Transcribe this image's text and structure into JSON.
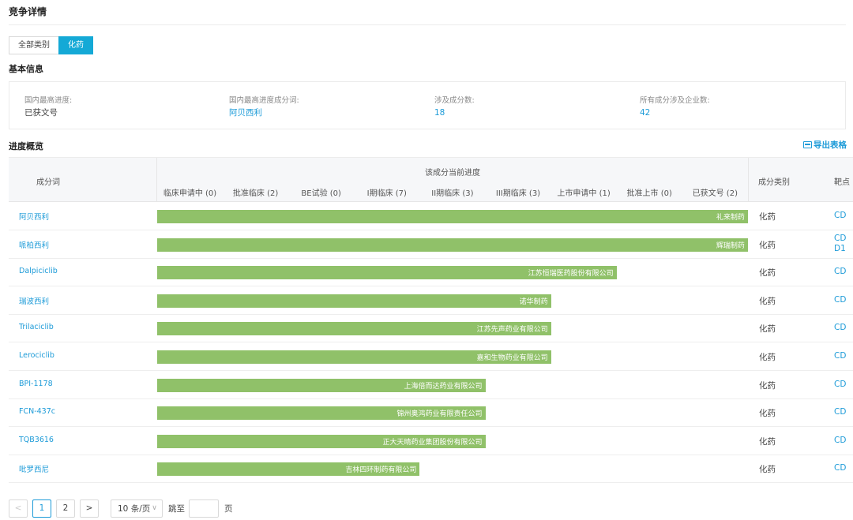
{
  "page": {
    "title": "竞争详情"
  },
  "category_tabs": [
    {
      "label": "全部类别",
      "active": false
    },
    {
      "label": "化药",
      "active": true
    }
  ],
  "basic_info": {
    "heading": "基本信息",
    "items": [
      {
        "label": "国内最高进度:",
        "value": "已获文号",
        "is_link": false
      },
      {
        "label": "国内最高进度成分词:",
        "value": "阿贝西利",
        "is_link": true
      },
      {
        "label": "涉及成分数:",
        "value": "18",
        "is_link": true
      },
      {
        "label": "所有成分涉及企业数:",
        "value": "42",
        "is_link": true
      }
    ]
  },
  "progress": {
    "heading": "进度概览",
    "export_label": "导出表格",
    "columns": {
      "name": "成分词",
      "progress_group": "该成分当前进度",
      "type": "成分类别",
      "target": "靶点"
    },
    "stages": [
      "临床申请中 (0)",
      "批准临床 (2)",
      "BE试验 (0)",
      "I期临床 (7)",
      "II期临床 (3)",
      "III期临床 (3)",
      "上市申请中 (1)",
      "批准上市 (0)",
      "已获文号 (2)"
    ],
    "bar_color": "#90c169",
    "rows": [
      {
        "name": "阿贝西利",
        "company": "礼来制药",
        "stage_reached": 9,
        "type": "化药",
        "target": [
          "CD"
        ]
      },
      {
        "name": "哌柏西利",
        "company": "辉瑞制药",
        "stage_reached": 9,
        "type": "化药",
        "target": [
          "CD",
          "D1"
        ]
      },
      {
        "name": "Dalpiciclib",
        "company": "江苏恒瑞医药股份有限公司",
        "stage_reached": 7,
        "type": "化药",
        "target": [
          "CD"
        ]
      },
      {
        "name": "瑞波西利",
        "company": "诺华制药",
        "stage_reached": 6,
        "type": "化药",
        "target": [
          "CD"
        ]
      },
      {
        "name": "Trilaciclib",
        "company": "江苏先声药业有限公司",
        "stage_reached": 6,
        "type": "化药",
        "target": [
          "CD"
        ]
      },
      {
        "name": "Lerociclib",
        "company": "嘉和生物药业有限公司",
        "stage_reached": 6,
        "type": "化药",
        "target": [
          "CD"
        ]
      },
      {
        "name": "BPI-1178",
        "company": "上海倍而达药业有限公司",
        "stage_reached": 5,
        "type": "化药",
        "target": [
          "CD"
        ]
      },
      {
        "name": "FCN-437c",
        "company": "锦州奥鸿药业有限责任公司",
        "stage_reached": 5,
        "type": "化药",
        "target": [
          "CD"
        ]
      },
      {
        "name": "TQB3616",
        "company": "正大天晴药业集团股份有限公司",
        "stage_reached": 5,
        "type": "化药",
        "target": [
          "CD"
        ]
      },
      {
        "name": "吡罗西尼",
        "company": "吉林四环制药有限公司",
        "stage_reached": 4,
        "type": "化药",
        "target": [
          "CD"
        ]
      }
    ]
  },
  "pagination": {
    "prev": "<",
    "pages": [
      "1",
      "2"
    ],
    "current": "1",
    "next": ">",
    "page_size": "10 条/页",
    "jump_label": "跳至",
    "jump_value": "",
    "page_unit": "页"
  }
}
